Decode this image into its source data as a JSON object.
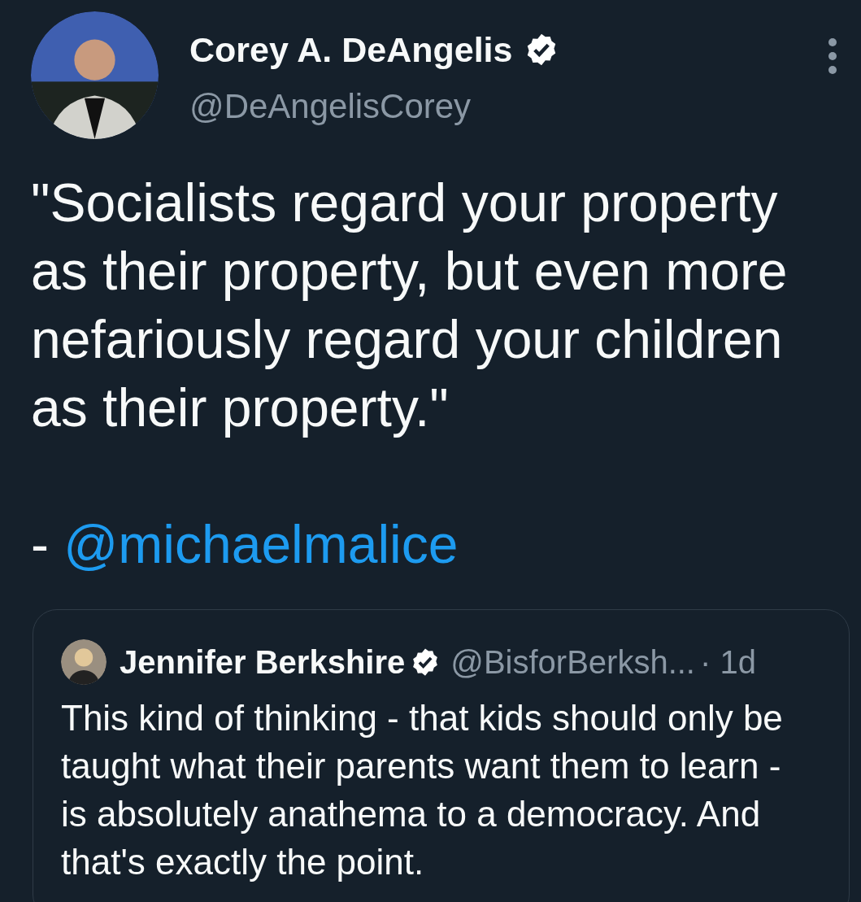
{
  "tweet": {
    "author": {
      "name": "Corey A. DeAngelis",
      "verified": true,
      "handle": "@DeAngelisCorey"
    },
    "text": "\"Socialists regard your property\nas their property, but even more\nnefariously regard your children\nas their property.\"",
    "attribution_prefix": "- ",
    "mention": "@michaelmalice",
    "quoted_tweet": {
      "author": {
        "name": "Jennifer Berkshire",
        "verified": true,
        "handle": "@BisforBerksh...",
        "time": "· 1d"
      },
      "text": "This kind of thinking - that kids should only be\ntaught what their parents want them to learn -\nis absolutely anathema to a democracy. And\nthat's exactly the point."
    }
  }
}
